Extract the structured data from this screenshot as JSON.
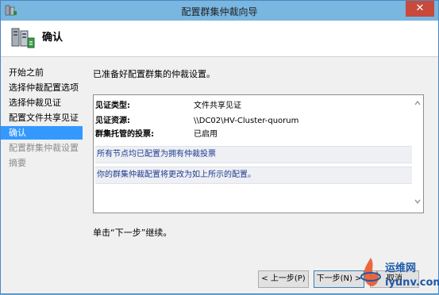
{
  "window": {
    "title": "配置群集仲裁向导",
    "close_glyph": "✕"
  },
  "header": {
    "title": "确认"
  },
  "nav": {
    "items": [
      {
        "label": "开始之前",
        "state": "normal"
      },
      {
        "label": "选择仲裁配置选项",
        "state": "normal"
      },
      {
        "label": "选择仲裁见证",
        "state": "normal"
      },
      {
        "label": "配置文件共享见证",
        "state": "normal"
      },
      {
        "label": "确认",
        "state": "active"
      },
      {
        "label": "配置群集仲裁设置",
        "state": "disabled"
      },
      {
        "label": "摘要",
        "state": "disabled"
      }
    ]
  },
  "content": {
    "intro": "已准备好配置群集的仲裁设置。",
    "summary": {
      "rows": [
        {
          "key": "见证类型:",
          "value": "文件共享见证"
        },
        {
          "key": "见证资源:",
          "value": "\\\\DC02\\HV-Cluster-quorum"
        },
        {
          "key": "群集托管的投票:",
          "value": "已启用"
        }
      ],
      "notes": [
        "所有节点均已配置为拥有仲裁投票",
        "你的群集仲裁配置将更改为如上所示的配置。"
      ]
    },
    "footer": "单击“下一步”继续。"
  },
  "buttons": {
    "prev": "< 上一步(P)",
    "next": "下一步(N) >",
    "cancel": "取消"
  },
  "watermark": {
    "cn": "运维网",
    "en": "iyunv.com"
  },
  "colors": {
    "titlebar": "#79b6e0",
    "selected": "#3399ff",
    "close": "#c74a3c",
    "note_text": "#1f3b8f"
  }
}
